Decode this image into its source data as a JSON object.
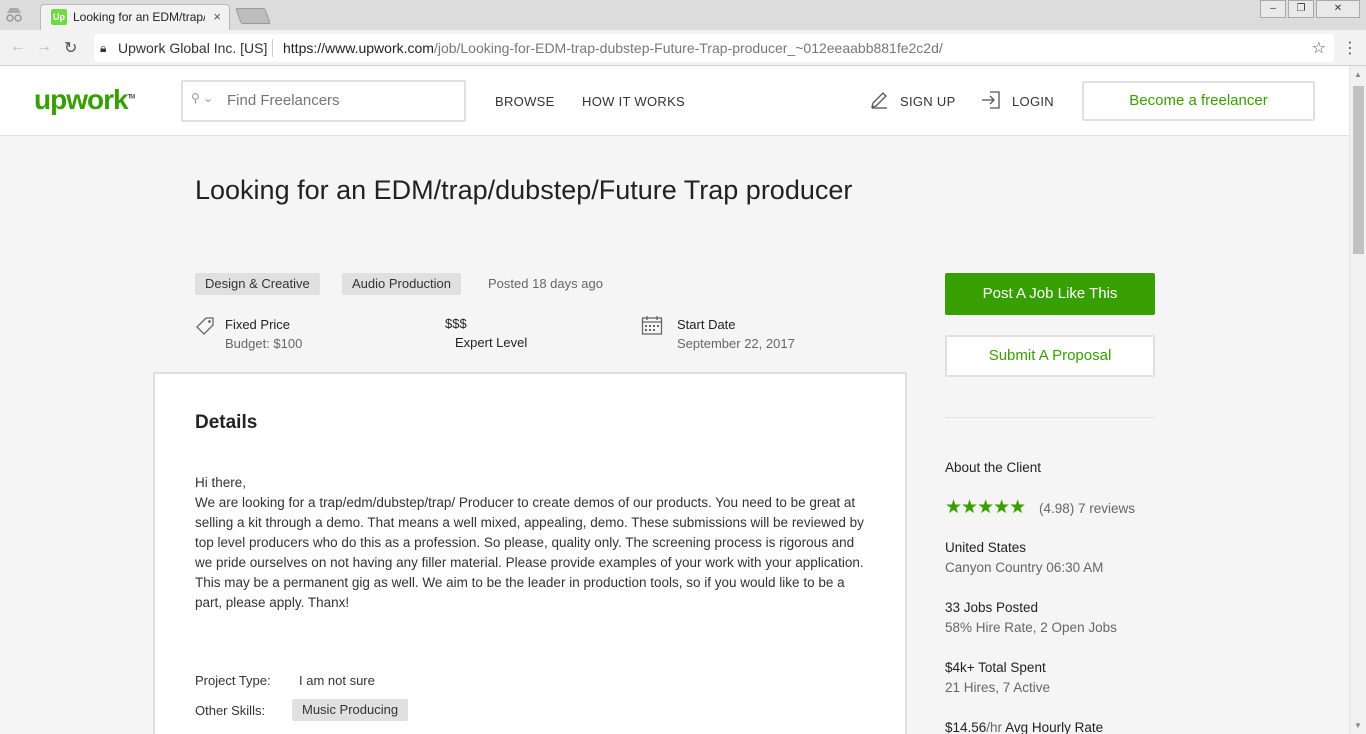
{
  "browser": {
    "tab_title": "Looking for an EDM/trap/dubstep/Future Trap producer",
    "tab_favicon": "Up",
    "close_glyph": "×",
    "org_label": "Upwork Global Inc. [US]",
    "url_host": "https://www.upwork.com",
    "url_path": "/job/Looking-for-EDM-trap-dubstep-Future-Trap-producer_~012eeaabb881fe2c2d/"
  },
  "header": {
    "logo": "upwork",
    "logo_tm": "TM",
    "search_placeholder": "Find Freelancers",
    "nav": [
      "BROWSE",
      "HOW IT WORKS"
    ],
    "sign_up": "SIGN UP",
    "login": "LOGIN",
    "become_freelancer": "Become a freelancer"
  },
  "job": {
    "title": "Looking for an EDM/trap/dubstep/Future Trap producer",
    "categories": [
      "Design & Creative",
      "Audio Production"
    ],
    "posted": "Posted 18 days ago",
    "price_type": "Fixed Price",
    "budget": "Budget: $100",
    "level_symbol": "$$$",
    "level": "Expert Level",
    "start_label": "Start Date",
    "start_date": "September 22, 2017"
  },
  "details": {
    "heading": "Details",
    "greeting": "Hi there,",
    "body": "We are looking for a trap/edm/dubstep/trap/ Producer to create demos of our products. You need to be great at selling a kit through a demo. That means a well mixed, appealing, demo. These submissions will be reviewed by top level producers who do this as a profession. So please, quality only. The screening process is rigorous and we pride ourselves on not having any filler material.  Please provide examples of your work with your application. This may be a permanent gig as well. We aim to be the leader in production tools, so if you would like to be a part, please apply. Thanx!",
    "project_type_label": "Project Type:",
    "project_type": "I am not sure",
    "other_skills_label": "Other Skills:",
    "skills": [
      "Music Producing"
    ]
  },
  "sidebar": {
    "post_job": "Post A Job Like This",
    "submit_proposal": "Submit A Proposal",
    "about_client": "About the Client",
    "stars": 5,
    "rating": "(4.98) 7 reviews",
    "country": "United States",
    "location_time": "Canyon Country 06:30 AM",
    "jobs_posted": "33 Jobs Posted",
    "hire_rate": "58% Hire Rate, 2 Open Jobs",
    "total_spent": "$4k+ Total Spent",
    "hires": "21 Hires, 7 Active",
    "hourly_rate_value": "$14.56",
    "hourly_rate_unit": "/hr",
    "hourly_rate_label": "Avg Hourly Rate"
  },
  "colors": {
    "brand_green": "#37a000",
    "chip_gray": "#e0e0e0"
  }
}
